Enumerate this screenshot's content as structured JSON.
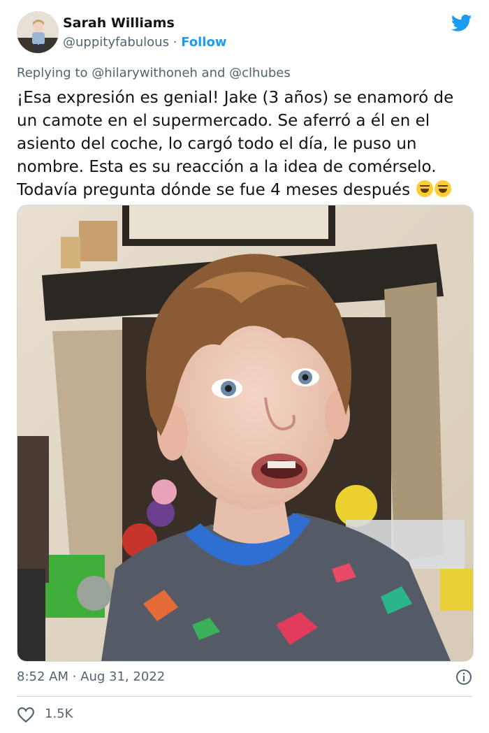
{
  "author": {
    "name": "Sarah Williams",
    "handle": "@uppityfabulous",
    "separator": "·",
    "follow_label": "Follow"
  },
  "reply": {
    "prefix": "Replying to",
    "mention1": "@hilarywithoneh",
    "joiner": "and",
    "mention2": "@clhubes"
  },
  "tweet": {
    "lines": [
      "¡Esa expresión es genial! Jake (3 años) se enamoró de",
      "un camote en el supermercado. Se aferró a él en el",
      "asiento del coche, lo cargó todo el día, le puso un",
      "nombre. Esta es su reacción a la idea de comérselo.",
      "Todavía pregunta dónde se fue 4 meses después"
    ],
    "emoji": "grinning-squinting-face-emoji"
  },
  "timestamp": "8:52 AM · Aug 31, 2022",
  "likes": "1.5K",
  "colors": {
    "accent": "#1d9bf0",
    "text": "#0f1419",
    "secondary": "#536471",
    "border": "#cfd9de"
  },
  "icons": [
    "twitter-bird-icon",
    "info-icon",
    "heart-icon"
  ]
}
